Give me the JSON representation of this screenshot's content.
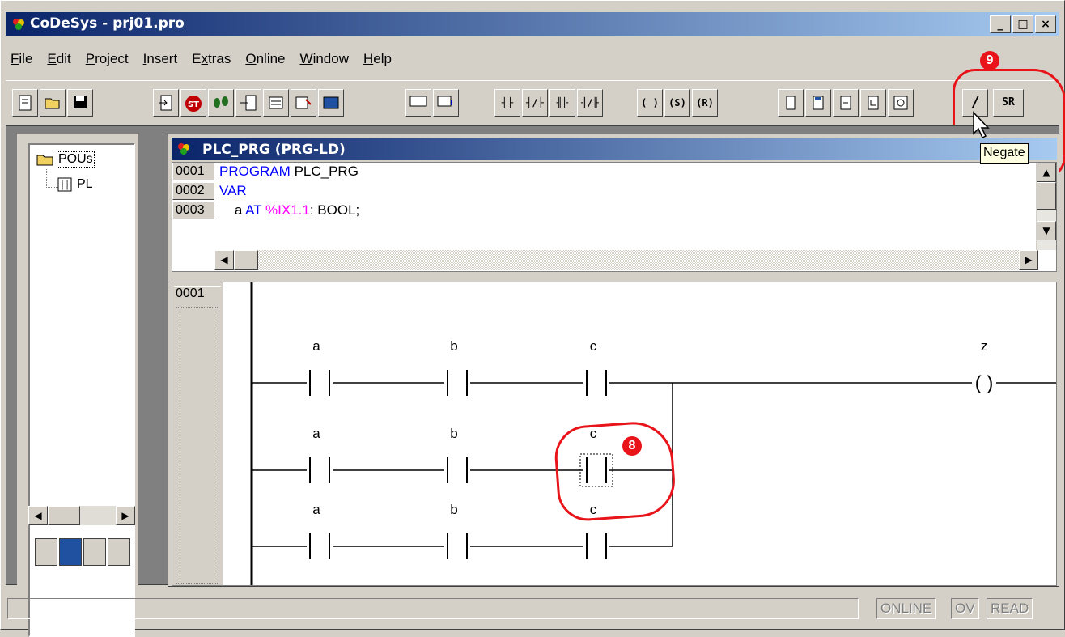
{
  "window": {
    "title": "CoDeSys - prj01.pro",
    "minimize": "_",
    "maximize": "□",
    "close": "×"
  },
  "menu": [
    {
      "label": "File",
      "u": "F"
    },
    {
      "label": "Edit",
      "u": "E"
    },
    {
      "label": "Project",
      "u": "P"
    },
    {
      "label": "Insert",
      "u": "I"
    },
    {
      "label": "Extras",
      "u": "x"
    },
    {
      "label": "Online",
      "u": "O"
    },
    {
      "label": "Window",
      "u": "W"
    },
    {
      "label": "Help",
      "u": "H"
    }
  ],
  "toolbar": {
    "negate_label": "/",
    "set_reset_label": "SR",
    "tooltip": "Negate"
  },
  "callouts": {
    "nine": "9",
    "eight": "8"
  },
  "object_organizer": {
    "root_label": "POUs",
    "child_label": "PL"
  },
  "editor": {
    "title": "PLC_PRG (PRG-LD)",
    "declaration": [
      {
        "num": "0001",
        "kw": "PROGRAM",
        "rest": " PLC_PRG"
      },
      {
        "num": "0002",
        "kw": "VAR",
        "rest": ""
      },
      {
        "num": "0003",
        "pre": "    a ",
        "kw": "AT ",
        "addr": "%IX1.1",
        "post": ": BOOL;"
      }
    ],
    "network_number": "0001",
    "rungs": [
      {
        "contacts": [
          "a",
          "b",
          "c"
        ],
        "coil": "z"
      },
      {
        "contacts": [
          "a",
          "b",
          "c"
        ]
      },
      {
        "contacts": [
          "a",
          "b",
          "c"
        ]
      }
    ]
  },
  "status": {
    "online": "ONLINE",
    "ov": "OV",
    "read": "READ"
  }
}
